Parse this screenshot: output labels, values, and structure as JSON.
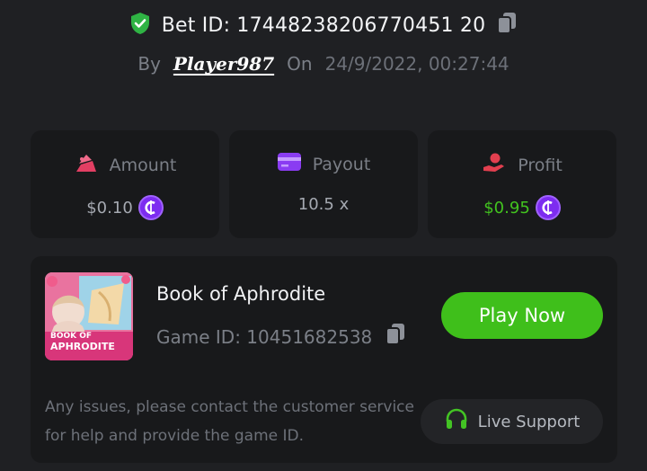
{
  "header": {
    "bet_id_label": "Bet ID: 17448238206770451 20",
    "by_label": "By",
    "player_name": "Player987",
    "on_label": "On",
    "date": "24/9/2022, 00:27:44"
  },
  "stats": {
    "amount": {
      "label": "Amount",
      "value": "$0.10"
    },
    "payout": {
      "label": "Payout",
      "value": "10.5 x"
    },
    "profit": {
      "label": "Profit",
      "value": "$0.95"
    }
  },
  "game": {
    "title": "Book of Aphrodite",
    "game_id_label": "Game ID: 10451682538",
    "thumb_text_line1": "BOOK OF",
    "thumb_text_line2": "APHRODITE",
    "play_label": "Play Now"
  },
  "support": {
    "message": "Any issues, please contact the customer service for help and provide the game ID.",
    "button_label": "Live Support"
  },
  "colors": {
    "background": "#1f2023",
    "card": "#18191b",
    "accent_green": "#3fbf1b",
    "coin_purple": "#7d2cf0"
  },
  "icons": {
    "verified": "shield-check-icon",
    "copy": "copy-icon",
    "amount": "wager-icon",
    "payout": "card-icon",
    "profit": "hand-coin-icon",
    "currency": "coin-icon",
    "support": "headset-icon"
  }
}
